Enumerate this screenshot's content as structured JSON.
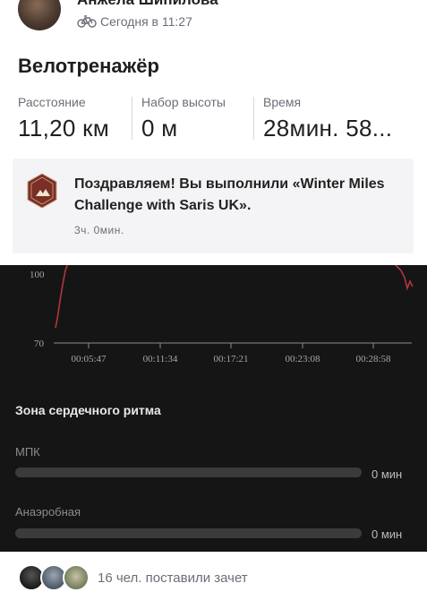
{
  "header": {
    "athlete_name": "Анжела Шипилова",
    "timestamp": "Сегодня в 11:27",
    "activity_icon": "bike-icon"
  },
  "activity": {
    "title": "Велотренажёр",
    "stats": [
      {
        "label": "Расстояние",
        "value": "11,20 км"
      },
      {
        "label": "Набор высоты",
        "value": "0 м"
      },
      {
        "label": "Время",
        "value": "28мин. 58..."
      }
    ]
  },
  "achievement": {
    "badge_icon": "winter-miles-badge-icon",
    "badge_text": "WINTER MILES CHALLENGE",
    "message": "Поздравляем! Вы выполнили «Winter Miles Challenge with Saris UK».",
    "time": "3ч. 0мин."
  },
  "heart_rate_chart": {
    "chart_data": {
      "type": "line",
      "y_ticks": [
        "100",
        "70"
      ],
      "x_ticks": [
        "00:05:47",
        "00:11:34",
        "00:17:21",
        "00:23:08",
        "00:28:58"
      ],
      "line_color": "#b0383f"
    }
  },
  "heart_zones": {
    "title": "Зона сердечного ритма",
    "zones": [
      {
        "label": "МПК",
        "value": "0 мин",
        "fraction": 0
      },
      {
        "label": "Анаэробная",
        "value": "0 мин",
        "fraction": 0
      }
    ]
  },
  "kudos": {
    "text": "16 чел. поставили зачет"
  },
  "colors": {
    "dark_bg": "#151515",
    "card_bg": "#f4f4f6",
    "muted_text": "#6d6d78"
  }
}
